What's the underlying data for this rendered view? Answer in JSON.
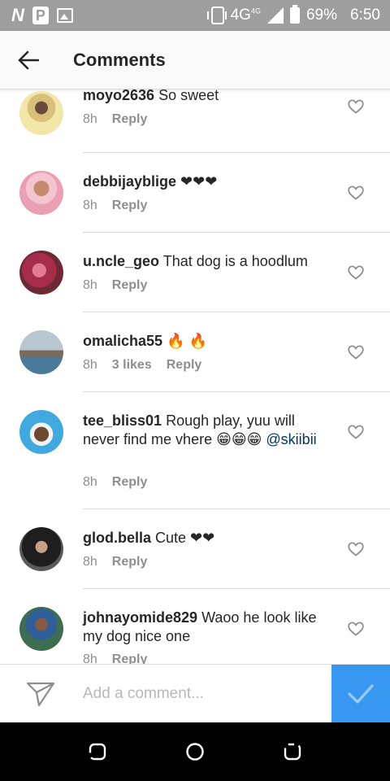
{
  "status_bar": {
    "network": "4G",
    "network_sup": "4G",
    "battery": "69%",
    "time": "6:50"
  },
  "header": {
    "title": "Comments"
  },
  "comments": [
    {
      "username": "moyo2636",
      "text": "So sweet",
      "time": "8h",
      "likes": "",
      "reply": "Reply",
      "avatar_color": "#d8b66a"
    },
    {
      "username": "debbijayblige",
      "text": "❤❤❤",
      "time": "8h",
      "likes": "",
      "reply": "Reply",
      "avatar_color": "#e9b7c3"
    },
    {
      "username": "u.ncle_geo",
      "text": "That dog is a hoodlum",
      "time": "8h",
      "likes": "",
      "reply": "Reply",
      "avatar_color": "#b5475f"
    },
    {
      "username": "omalicha55",
      "text": "🔥 🔥",
      "time": "8h",
      "likes": "3 likes",
      "reply": "Reply",
      "avatar_color": "#8fa0a8"
    },
    {
      "username": "tee_bliss01",
      "text": "Rough play,  yuu will never find me vhere 😁😁😁",
      "mention": "@skiibii",
      "time": "8h",
      "likes": "",
      "reply": "Reply",
      "avatar_color": "#3fa9e0"
    },
    {
      "username": "glod.bella",
      "text": "Cute ❤❤",
      "time": "8h",
      "likes": "",
      "reply": "Reply",
      "avatar_color": "#2b2b2b"
    },
    {
      "username": "johnayomide829",
      "text": "Waoo  he look like my dog nice one",
      "time": "8h",
      "likes": "",
      "reply": "Reply",
      "avatar_color": "#3c6e4f"
    }
  ],
  "input": {
    "placeholder": "Add a comment..."
  },
  "colors": {
    "accent": "#3897f0",
    "mention": "#003569",
    "meta": "#8e8e8e"
  },
  "icons": {
    "back": "arrow-left-icon",
    "like": "heart-outline-icon",
    "send": "paper-plane-icon",
    "post": "check-icon"
  }
}
